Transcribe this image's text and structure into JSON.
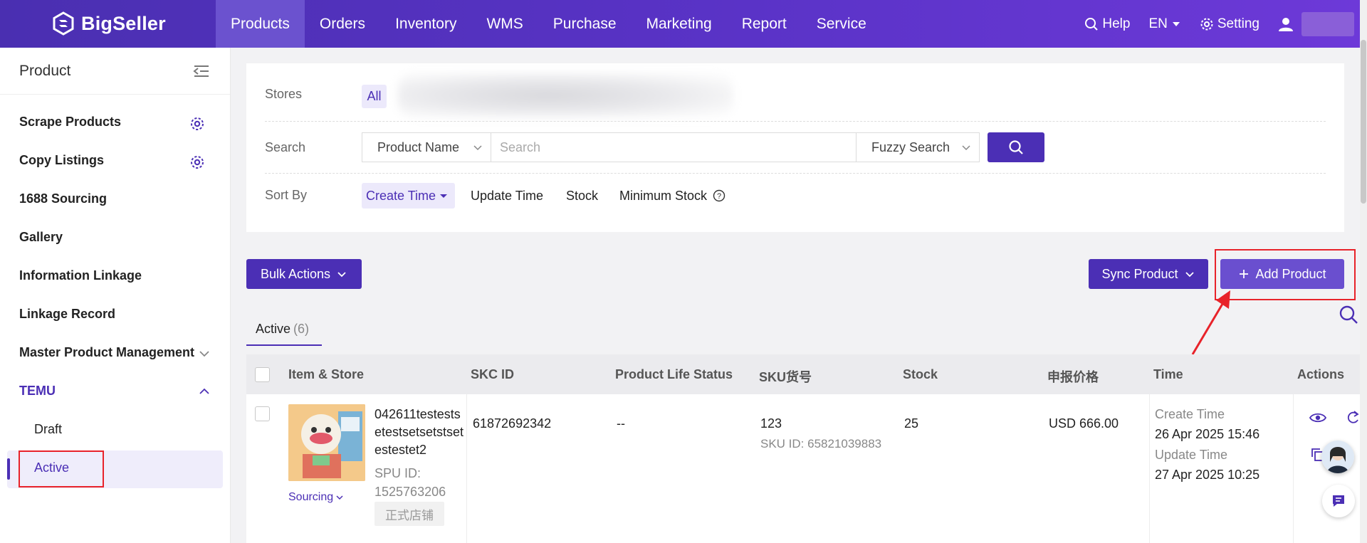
{
  "brand": {
    "name": "BigSeller"
  },
  "nav": {
    "items": [
      {
        "label": "Products",
        "active": true
      },
      {
        "label": "Orders"
      },
      {
        "label": "Inventory"
      },
      {
        "label": "WMS"
      },
      {
        "label": "Purchase"
      },
      {
        "label": "Marketing"
      },
      {
        "label": "Report"
      },
      {
        "label": "Service"
      }
    ],
    "help": "Help",
    "language": "EN",
    "setting": "Setting"
  },
  "sidebar": {
    "title": "Product",
    "items": [
      {
        "label": "Scrape Products",
        "icon": "gear-icon"
      },
      {
        "label": "Copy Listings",
        "icon": "gear-icon"
      },
      {
        "label": "1688 Sourcing"
      },
      {
        "label": "Gallery"
      },
      {
        "label": "Information Linkage"
      },
      {
        "label": "Linkage Record"
      },
      {
        "label": "Master Product Management",
        "icon": "chevron-down-icon"
      },
      {
        "label": "TEMU",
        "icon": "chevron-up-icon",
        "expanded": true
      }
    ],
    "subitems": [
      {
        "label": "Draft"
      },
      {
        "label": "Active",
        "active": true
      }
    ]
  },
  "filter": {
    "stores_label": "Stores",
    "stores_all": "All",
    "search_label": "Search",
    "search_field": "Product Name",
    "search_placeholder": "Search",
    "search_mode": "Fuzzy Search",
    "sort_label": "Sort By",
    "sort_options": [
      "Create Time",
      "Update Time",
      "Stock",
      "Minimum Stock"
    ]
  },
  "toolbar": {
    "bulk_actions": "Bulk Actions",
    "sync_product": "Sync Product",
    "add_product": "Add Product"
  },
  "tabs": [
    {
      "label": "Active",
      "count": "(6)"
    }
  ],
  "table": {
    "columns": [
      "Item & Store",
      "SKC ID",
      "Product Life Status",
      "SKU货号",
      "Stock",
      "申报价格",
      "Time",
      "Actions"
    ],
    "rows": [
      {
        "title": "042611testestsetestsetsetstsetestestet2",
        "spu_label": "SPU ID:",
        "spu_id": "1525763206",
        "store_tag": "正式店铺",
        "sourcing": "Sourcing",
        "skc_id": "61872692342",
        "life_status": "--",
        "sku": "123",
        "sku_id": "SKU ID: 65821039883",
        "stock": "25",
        "price": "USD 666.00",
        "create_label": "Create Time",
        "create_time": "26 Apr 2025 15:46",
        "update_label": "Update Time",
        "update_time": "27 Apr 2025 10:25"
      }
    ]
  },
  "colors": {
    "brand": "#4b2fb5",
    "highlight": "#e8232a"
  }
}
